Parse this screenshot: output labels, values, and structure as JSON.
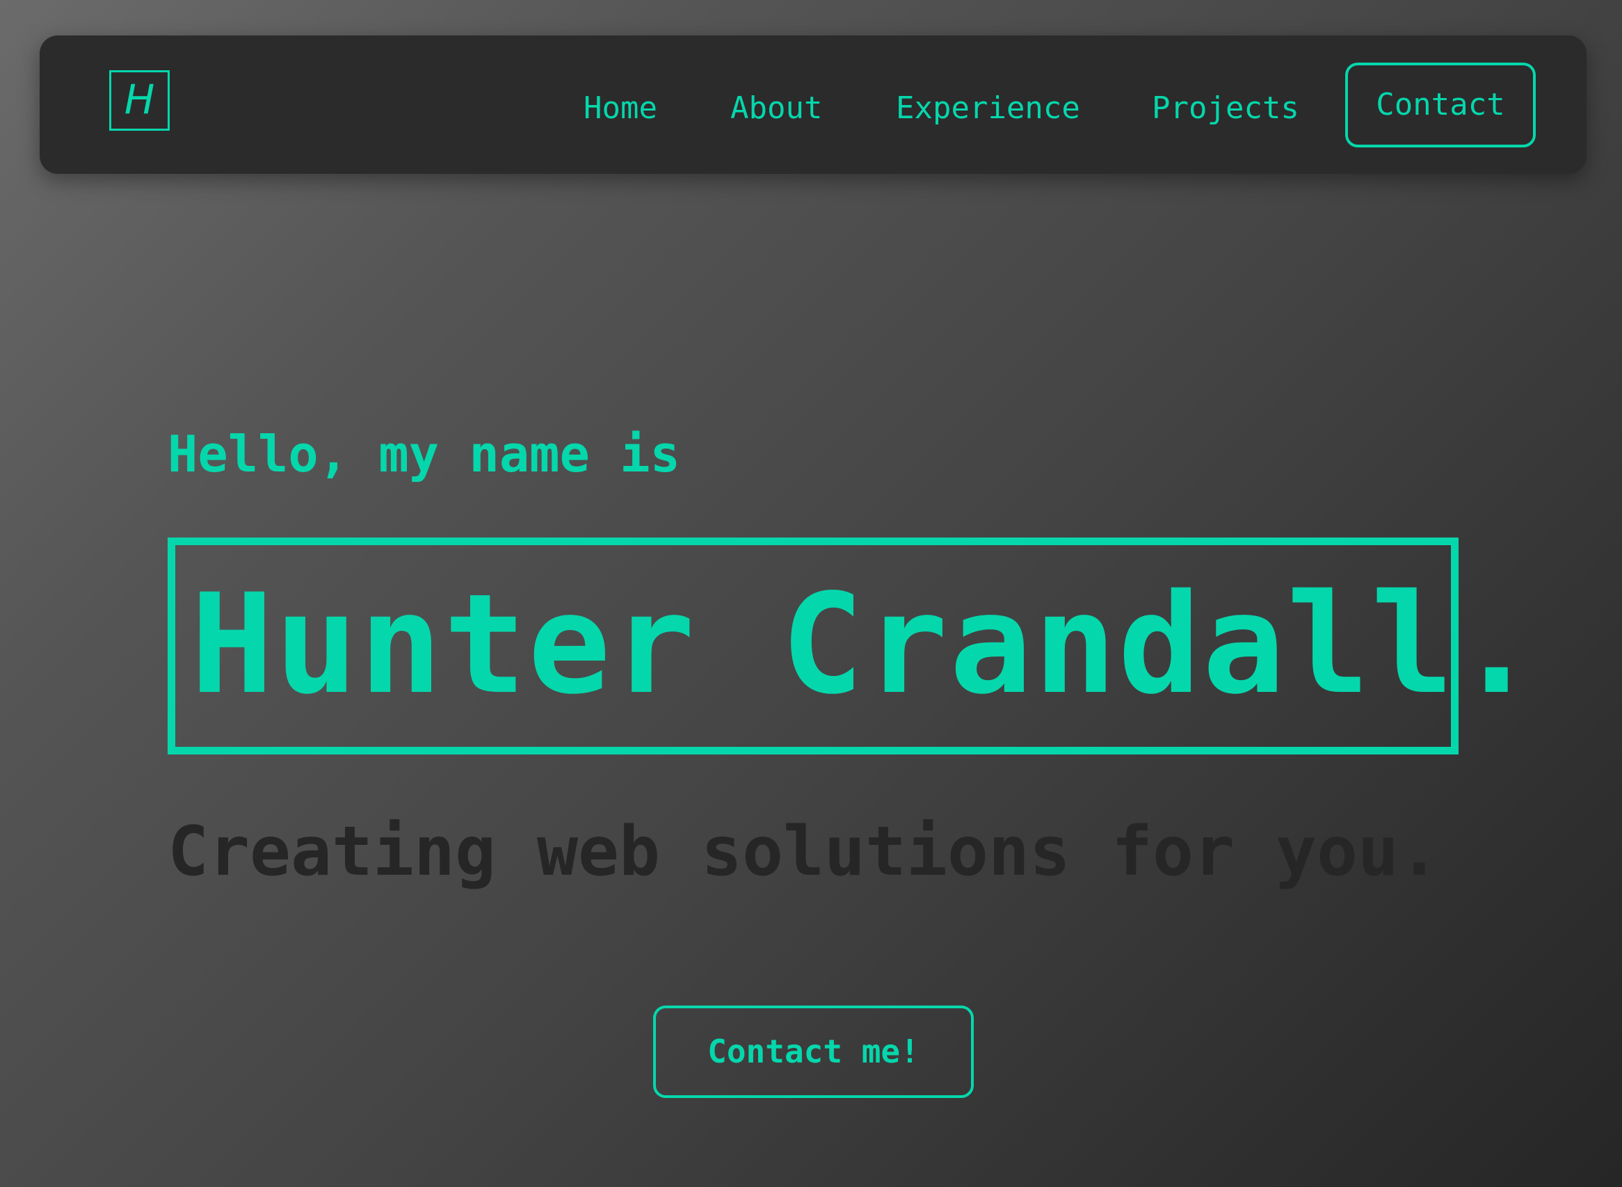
{
  "theme": {
    "accent": "#05d7ac",
    "nav_background": "#2b2b2b",
    "tagline_color": "#262626"
  },
  "navbar": {
    "logo_letter": "H",
    "links": [
      {
        "label": "Home"
      },
      {
        "label": "About"
      },
      {
        "label": "Experience"
      },
      {
        "label": "Projects"
      }
    ],
    "contact_label": "Contact"
  },
  "hero": {
    "greeting": "Hello, my name is",
    "name": "Hunter Crandall.",
    "tagline": "Creating web solutions for you.",
    "cta_label": "Contact me!"
  }
}
